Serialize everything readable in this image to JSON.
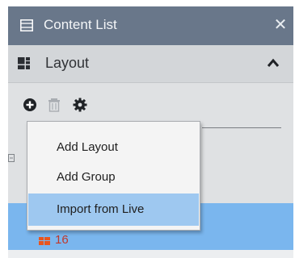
{
  "window": {
    "title": "Content List",
    "title_icon": "film-icon",
    "close_glyph": "✕"
  },
  "section": {
    "label": "Layout",
    "icon": "layout-grid-icon",
    "collapse_icon": "chevron-up-icon"
  },
  "toolbar": {
    "icons": [
      "add-circle-icon",
      "trash-icon",
      "gear-icon"
    ]
  },
  "context_menu": {
    "items": [
      {
        "label": "Add Layout"
      },
      {
        "label": "Add Group"
      },
      {
        "label": "Import from Live",
        "highlighted": true
      }
    ]
  },
  "selected_row": {
    "label": "16",
    "icon": "layout-icon-orange"
  },
  "colors": {
    "titlebar": "#69778a",
    "panel": "#dfe1e3",
    "selection": "#7ab6ee",
    "menu_highlight": "#9ec8f0",
    "accent": "#e8551f"
  }
}
